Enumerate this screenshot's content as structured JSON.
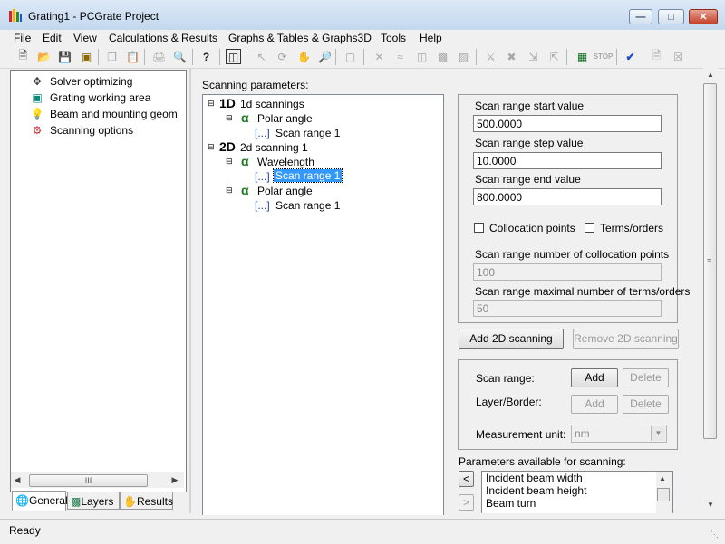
{
  "window": {
    "title": "Grating1 - PCGrate Project",
    "minimize_icon": "minimize-icon",
    "maximize_icon": "maximize-icon",
    "close_icon": "close-icon"
  },
  "menu": [
    "File",
    "Edit",
    "View",
    "Calculations & Results",
    "Graphs & Tables & Graphs3D",
    "Tools",
    "Help"
  ],
  "left_tree": [
    {
      "label": "Solver optimizing",
      "icon": "crosshair-icon"
    },
    {
      "label": "Grating working area",
      "icon": "grating-cube-icon"
    },
    {
      "label": "Beam and mounting geom",
      "icon": "lightbulb-icon"
    },
    {
      "label": "Scanning options",
      "icon": "scanning-icon"
    }
  ],
  "left_scrollbar_thumb": "III",
  "tabs": [
    {
      "label": "General",
      "icon": "globe-icon"
    },
    {
      "label": "Layers",
      "icon": "layers-icon"
    },
    {
      "label": "Results",
      "icon": "hand-results-icon"
    }
  ],
  "scanning": {
    "label": "Scanning parameters:",
    "tree": {
      "d1_prefix": "1D",
      "d1_label": "1d scannings",
      "d1_child": "Polar angle",
      "d1_range": "Scan range 1",
      "d2_prefix": "2D",
      "d2_label": "2d scanning 1",
      "d2_child1": "Wavelength",
      "d2_range1": "Scan range 1",
      "d2_child2": "Polar angle",
      "d2_range2": "Scan range 1",
      "alpha_symbol": "α",
      "range_bracket": "[...]",
      "collapse": "⊟"
    }
  },
  "range_panel": {
    "start_label": "Scan range start value",
    "start_value": "500.0000",
    "step_label": "Scan range step value",
    "step_value": "10.0000",
    "end_label": "Scan range end value",
    "end_value": "800.0000",
    "collocation_label": "Collocation points",
    "terms_label": "Terms/orders",
    "num_colloc_label": "Scan range number of collocation points",
    "num_colloc_value": "100",
    "max_terms_label": "Scan range maximal number of terms/orders",
    "max_terms_value": "50"
  },
  "buttons": {
    "add_2d": "Add 2D scanning",
    "remove_2d": "Remove 2D scanning"
  },
  "range_group": {
    "scan_range_label": "Scan range:",
    "layer_border_label": "Layer/Border:",
    "add": "Add",
    "delete": "Delete",
    "unit_label": "Measurement unit:",
    "unit_value": "nm"
  },
  "params_available": {
    "label": "Parameters available for scanning:",
    "items": [
      "Incident beam width",
      "Incident beam height",
      "Beam turn"
    ],
    "left_arrow": "<",
    "right_arrow": ">"
  },
  "status": "Ready"
}
